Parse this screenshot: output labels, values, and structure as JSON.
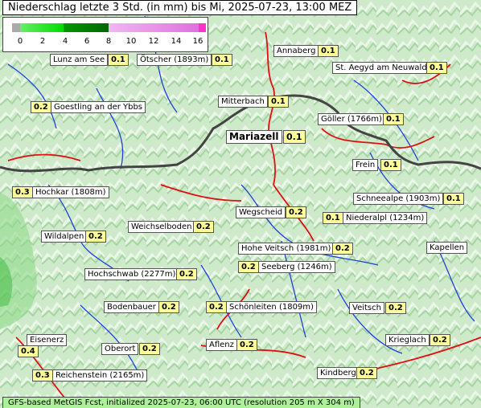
{
  "title": "Niederschlag letzte 3 Std. (in mm) bis Mi, 2025-07-23, 13:00 MEZ",
  "legend": {
    "ticks": [
      "0",
      "2",
      "4",
      "6",
      "8",
      "10",
      "12",
      "14",
      "16"
    ],
    "colors": [
      "#aaaaaa",
      "#00dd00",
      "#009900",
      "#f0b8f0",
      "#ff33cc"
    ]
  },
  "places": [
    {
      "id": "lunz",
      "name": "Lunz am See",
      "value": "0.1"
    },
    {
      "id": "oetscher",
      "name": "Ötscher (1893m)",
      "value": "0.1"
    },
    {
      "id": "annaberg",
      "name": "Annaberg",
      "value": "0.1"
    },
    {
      "id": "aegyd",
      "name": "St. Aegyd am Neuwald",
      "value": "0.1"
    },
    {
      "id": "goestling",
      "name": "Goestling an der Ybbs",
      "value": "0.2"
    },
    {
      "id": "mitterbach",
      "name": "Mitterbach",
      "value": "0.1"
    },
    {
      "id": "goeller",
      "name": "Göller (1766m)",
      "value": "0.1"
    },
    {
      "id": "mariazell",
      "name": "Mariazell",
      "value": "0.1"
    },
    {
      "id": "frein",
      "name": "Frein",
      "value": "0.1"
    },
    {
      "id": "hochkar",
      "name": "Hochkar (1808m)",
      "value": "0.3"
    },
    {
      "id": "schneealpe",
      "name": "Schneealpe (1903m)",
      "value": "0.1"
    },
    {
      "id": "wegscheid",
      "name": "Wegscheid",
      "value": "0.2"
    },
    {
      "id": "niederalpl",
      "name": "Niederalpl (1234m)",
      "value": "0.1"
    },
    {
      "id": "weichselboden",
      "name": "Weichselboden",
      "value": "0.2"
    },
    {
      "id": "wildalpen",
      "name": "Wildalpen",
      "value": "0.2"
    },
    {
      "id": "hoheveitsch",
      "name": "Hohe Veitsch (1981m)",
      "value": "0.2"
    },
    {
      "id": "kapellen",
      "name": "Kapellen",
      "value": ""
    },
    {
      "id": "seeberg",
      "name": "Seeberg (1246m)",
      "value": "0.2"
    },
    {
      "id": "hochschwab",
      "name": "Hochschwab (2277m)",
      "value": "0.2"
    },
    {
      "id": "bodenbauer",
      "name": "Bodenbauer",
      "value": "0.2"
    },
    {
      "id": "schoenleiten",
      "name": "Schönleiten (1809m)",
      "value": "0.2"
    },
    {
      "id": "veitsch",
      "name": "Veitsch",
      "value": "0.2"
    },
    {
      "id": "eisenerz",
      "name": "Eisenerz",
      "value": "0.4"
    },
    {
      "id": "oberort",
      "name": "Oberort",
      "value": "0.2"
    },
    {
      "id": "aflenz",
      "name": "Aflenz",
      "value": "0.2"
    },
    {
      "id": "krieglach",
      "name": "Krieglach",
      "value": "0.2"
    },
    {
      "id": "reichenstein",
      "name": "Reichenstein (2165m)",
      "value": "0.3"
    },
    {
      "id": "kindberg",
      "name": "Kindberg",
      "value": "0.2"
    }
  ],
  "footer": "GFS-based MetGIS Fcst, initialized 2025-07-23, 06:00 UTC  (resolution 205 m X 304 m)"
}
